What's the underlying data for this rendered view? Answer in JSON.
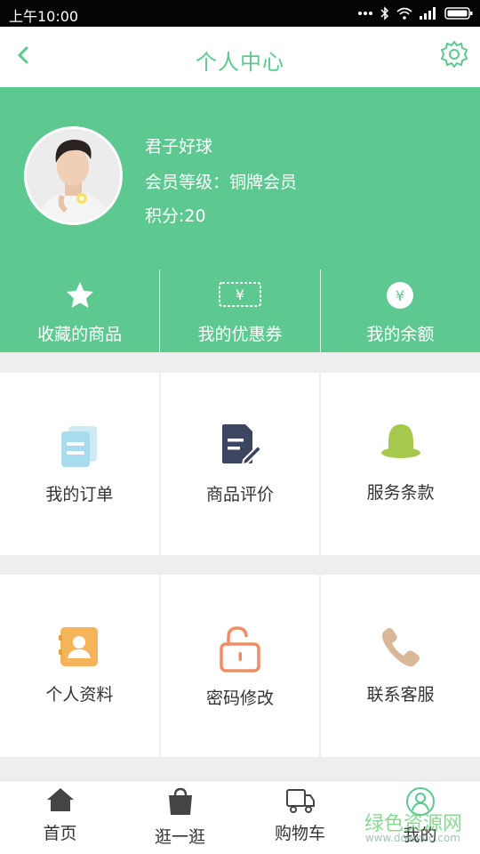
{
  "status_bar": {
    "time": "上午10:00"
  },
  "header": {
    "title": "个人中心"
  },
  "profile": {
    "name": "君子好球",
    "level": "会员等级：铜牌会员",
    "points": "积分:20"
  },
  "quick_actions": [
    {
      "label": "收藏的商品",
      "icon": "star-icon"
    },
    {
      "label": "我的优惠券",
      "icon": "coupon-icon"
    },
    {
      "label": "我的余额",
      "icon": "yuan-coin-icon"
    }
  ],
  "menu_row1": [
    {
      "label": "我的订单",
      "icon": "orders-icon",
      "color": "#a9dbee"
    },
    {
      "label": "商品评价",
      "icon": "edit-document-icon",
      "color": "#3d4660"
    },
    {
      "label": "服务条款",
      "icon": "bell-icon",
      "color": "#a5c84d"
    }
  ],
  "menu_row2": [
    {
      "label": "个人资料",
      "icon": "contact-card-icon",
      "color": "#f4b55a"
    },
    {
      "label": "密码修改",
      "icon": "unlock-icon",
      "color": "#ef8d66"
    },
    {
      "label": "联系客服",
      "icon": "phone-icon",
      "color": "#d9b89a"
    }
  ],
  "tab_bar": [
    {
      "label": "首页",
      "icon": "home-icon"
    },
    {
      "label": "逛一逛",
      "icon": "shopping-bag-icon"
    },
    {
      "label": "购物车",
      "icon": "truck-icon"
    },
    {
      "label": "我的",
      "icon": "user-icon",
      "active": true
    }
  ],
  "watermark": {
    "text": "绿色资源网",
    "url": "www.downcc.com"
  },
  "colors": {
    "accent": "#5dc88f",
    "title": "#5cc98f"
  }
}
